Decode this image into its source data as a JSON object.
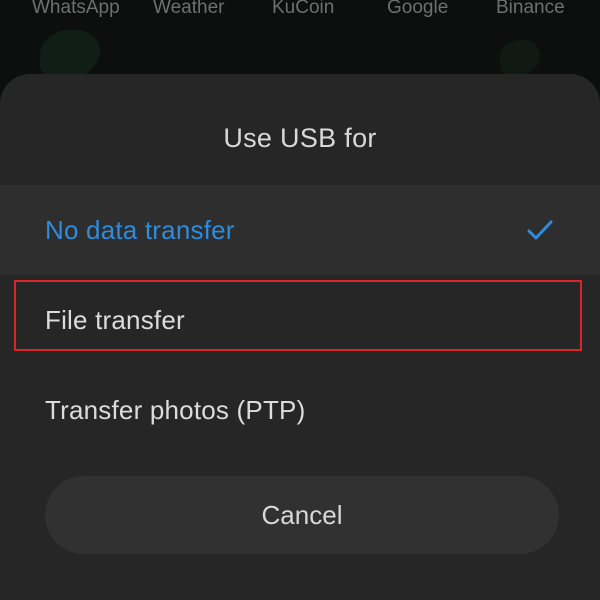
{
  "home_screen": {
    "app_labels": [
      "WhatsApp",
      "Weather",
      "KuCoin",
      "Google",
      "Binance"
    ]
  },
  "dialog": {
    "title": "Use USB for",
    "options": [
      {
        "label": "No data transfer",
        "selected": true
      },
      {
        "label": "File transfer",
        "selected": false,
        "highlighted": true
      },
      {
        "label": "Transfer photos (PTP)",
        "selected": false
      }
    ],
    "cancel_label": "Cancel"
  },
  "colors": {
    "selected_text": "#2f8bdc",
    "highlight_border": "#d9262b",
    "sheet_background": "#262626"
  },
  "icons": {
    "selected_indicator": "check-icon"
  }
}
